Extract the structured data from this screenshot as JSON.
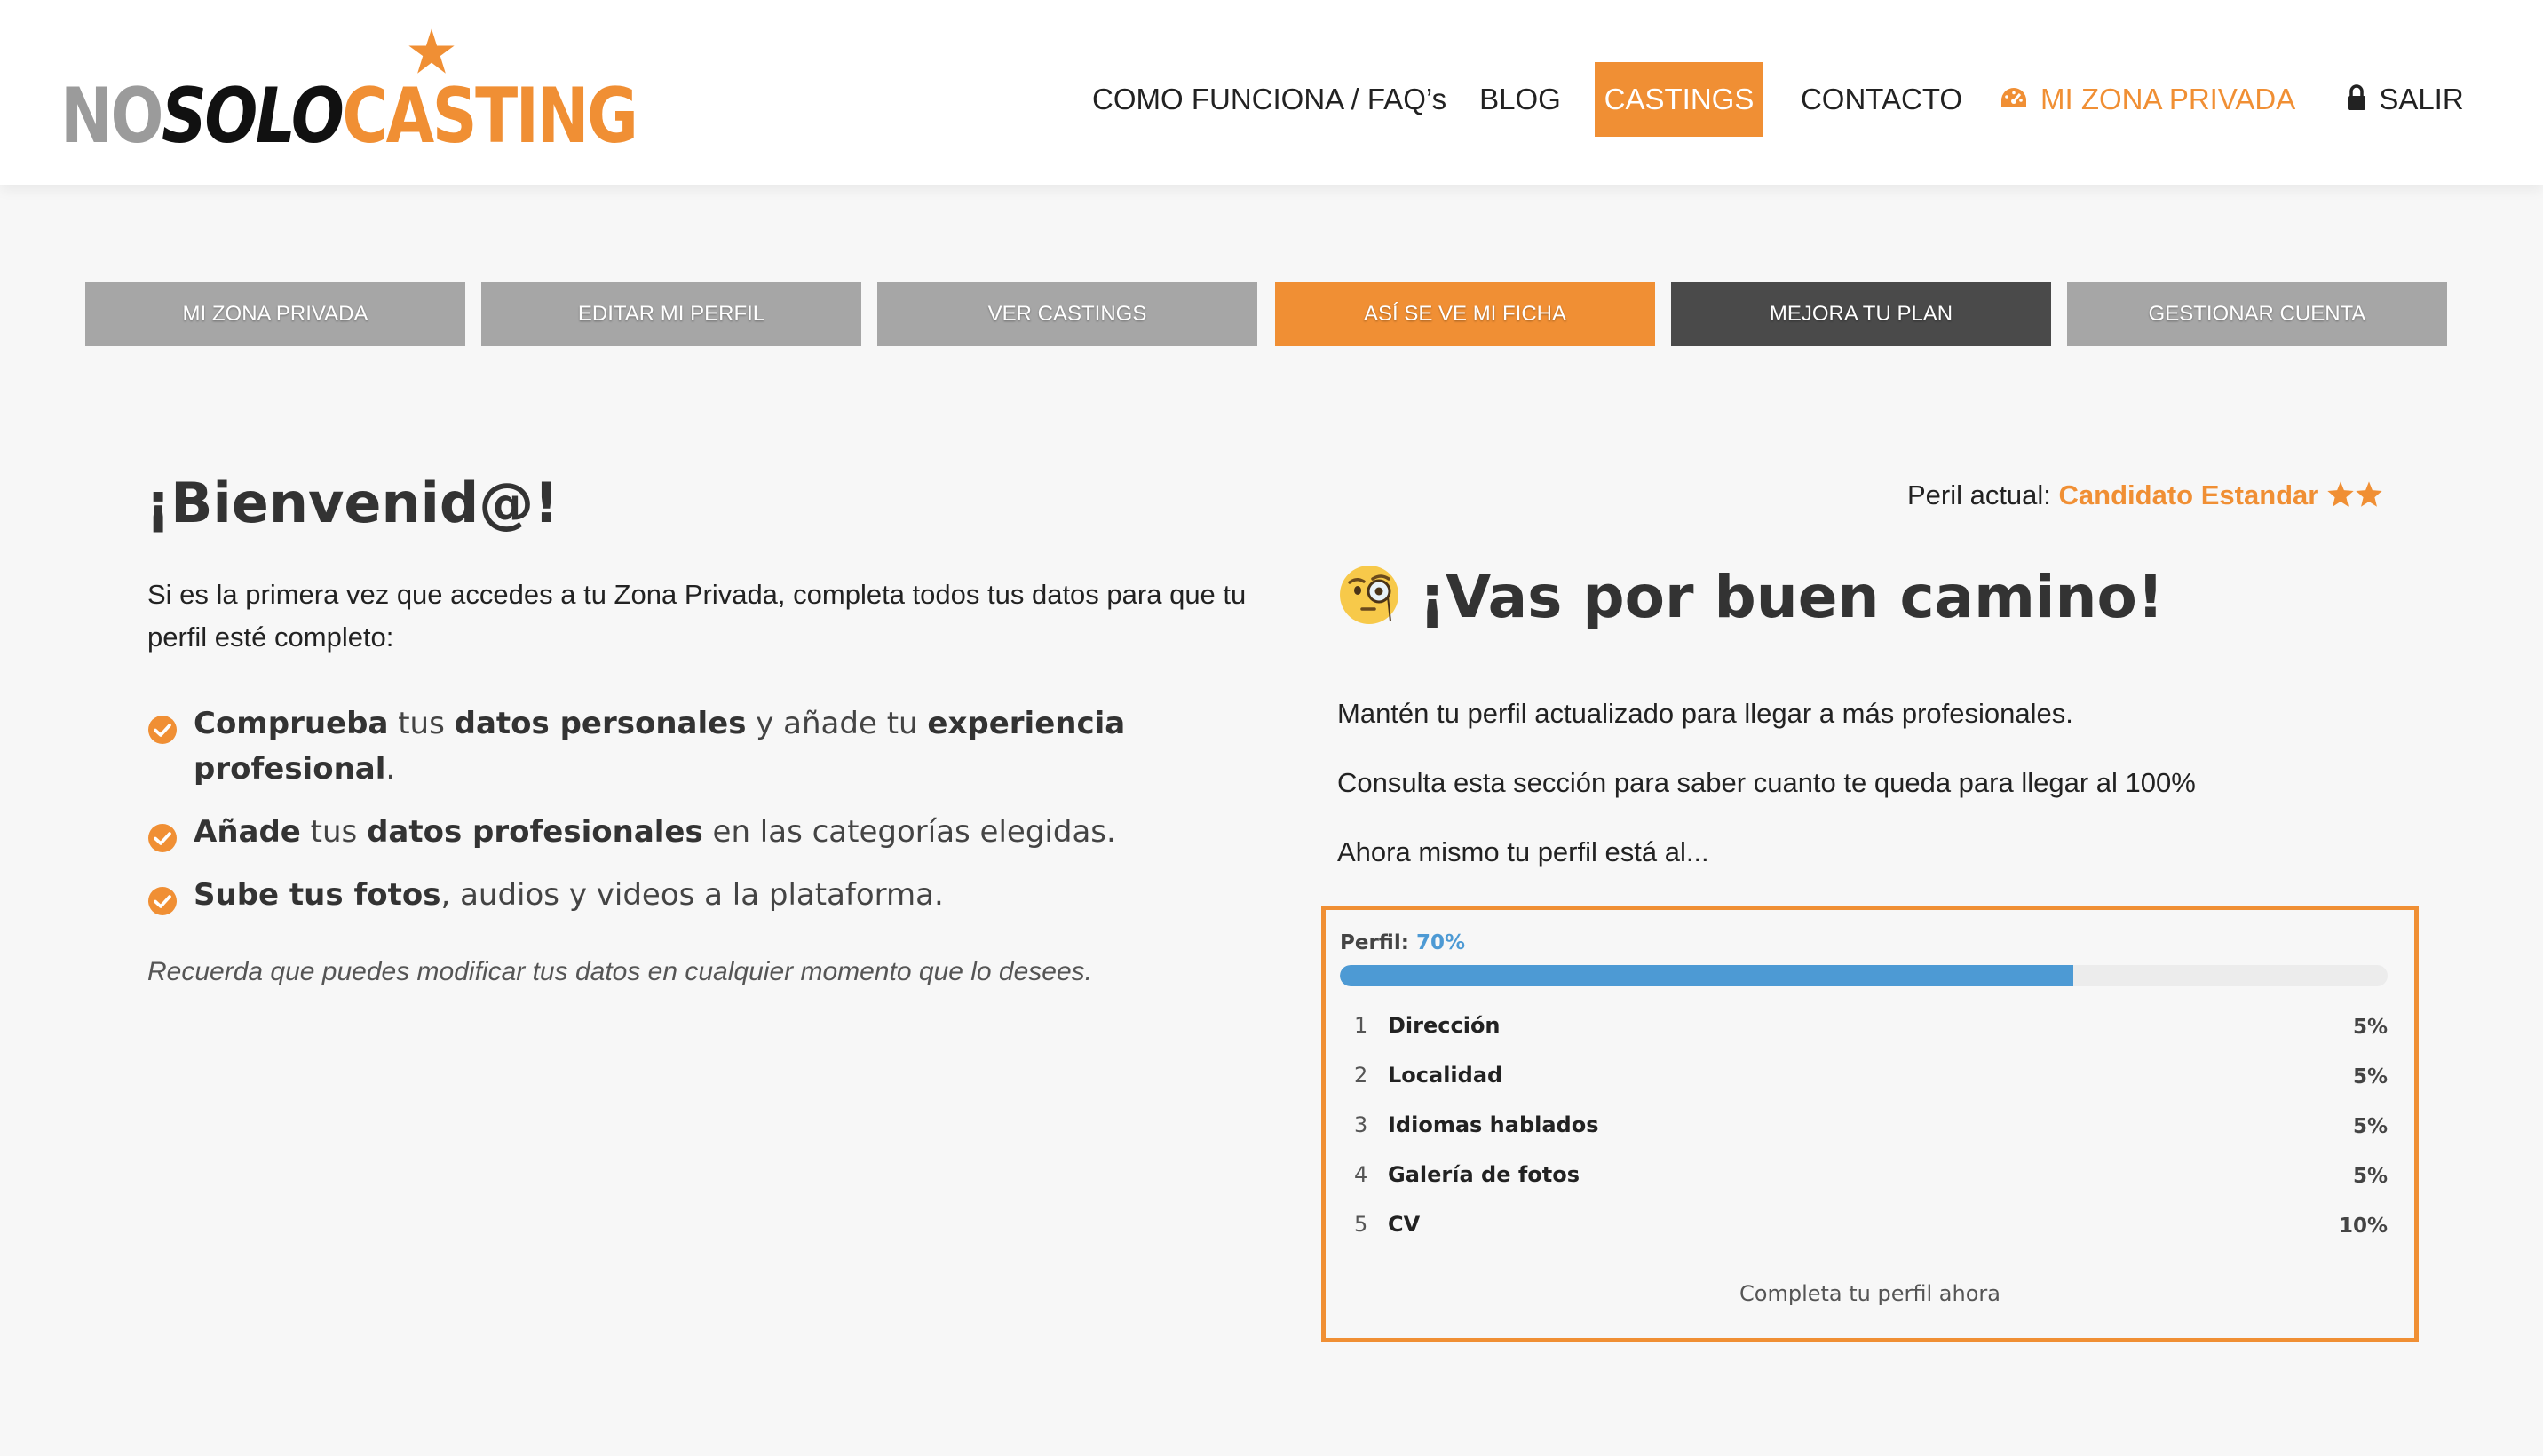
{
  "header": {
    "logo": {
      "part1": "NO",
      "part2": "SOLO",
      "part3": "CASTING"
    },
    "nav": [
      {
        "label": "COMO FUNCIONA / FAQ’s"
      },
      {
        "label": "BLOG"
      },
      {
        "label": "CASTINGS",
        "active": true
      },
      {
        "label": "CONTACTO"
      },
      {
        "label": "MI ZONA PRIVADA",
        "icon": "dashboard-icon"
      },
      {
        "label": "SALIR",
        "icon": "lock-icon"
      }
    ]
  },
  "subnav": [
    {
      "label": "MI ZONA PRIVADA"
    },
    {
      "label": "EDITAR MI PERFIL"
    },
    {
      "label": "VER CASTINGS"
    },
    {
      "label": "ASÍ SE VE MI FICHA",
      "active": true
    },
    {
      "label": "MEJORA TU PLAN"
    },
    {
      "label": "GESTIONAR CUENTA"
    }
  ],
  "welcome": {
    "title": "¡Bienvenid@!",
    "intro": "Si es la primera vez que accedes a tu Zona Privada, completa  todos tus datos para que tu perfil esté completo:",
    "checklist": [
      [
        {
          "t": "Comprueba",
          "b": true
        },
        {
          "t": " tus ",
          "b": false
        },
        {
          "t": "datos personales",
          "b": true
        },
        {
          "t": " y añade tu ",
          "b": false
        },
        {
          "t": "experiencia profesional",
          "b": true
        },
        {
          "t": ".",
          "b": false
        }
      ],
      [
        {
          "t": "Añade",
          "b": true
        },
        {
          "t": " tus ",
          "b": false
        },
        {
          "t": "datos profesionales",
          "b": true
        },
        {
          "t": " en las categorías elegidas.",
          "b": false
        }
      ],
      [
        {
          "t": "Sube tus fotos",
          "b": true
        },
        {
          "t": ", audios y videos a la plataforma.",
          "b": false
        }
      ]
    ],
    "reminder": "Recuerda que puedes modificar tus datos en cualquier momento que lo desees."
  },
  "profile": {
    "current_label": "Peril actual:",
    "current_value": "Candidato Estandar",
    "stars": 2,
    "title": "¡Vas por buen camino!",
    "emoji": "monocle-face-icon",
    "para1": "Mantén tu perfil actualizado para llegar a más profesionales.",
    "para2": "Consulta esta sección para saber cuanto te queda para llegar al 100%",
    "para3": "Ahora mismo tu perfil está al...",
    "progress_label": "Perfil:",
    "progress_value": "70%",
    "progress_fraction": 0.7,
    "tasks": [
      {
        "num": "1",
        "name": "Dirección",
        "pct": "5%"
      },
      {
        "num": "2",
        "name": "Localidad",
        "pct": "5%"
      },
      {
        "num": "3",
        "name": "Idiomas hablados",
        "pct": "5%"
      },
      {
        "num": "4",
        "name": "Galería de fotos",
        "pct": "5%"
      },
      {
        "num": "5",
        "name": "CV",
        "pct": "10%"
      }
    ],
    "complete_link": "Completa tu perfil ahora"
  },
  "colors": {
    "accent": "#f08f34",
    "progress": "#4d9ad4",
    "subnav_gray": "#a6a6a6",
    "subnav_dark": "#4a4a4a"
  }
}
